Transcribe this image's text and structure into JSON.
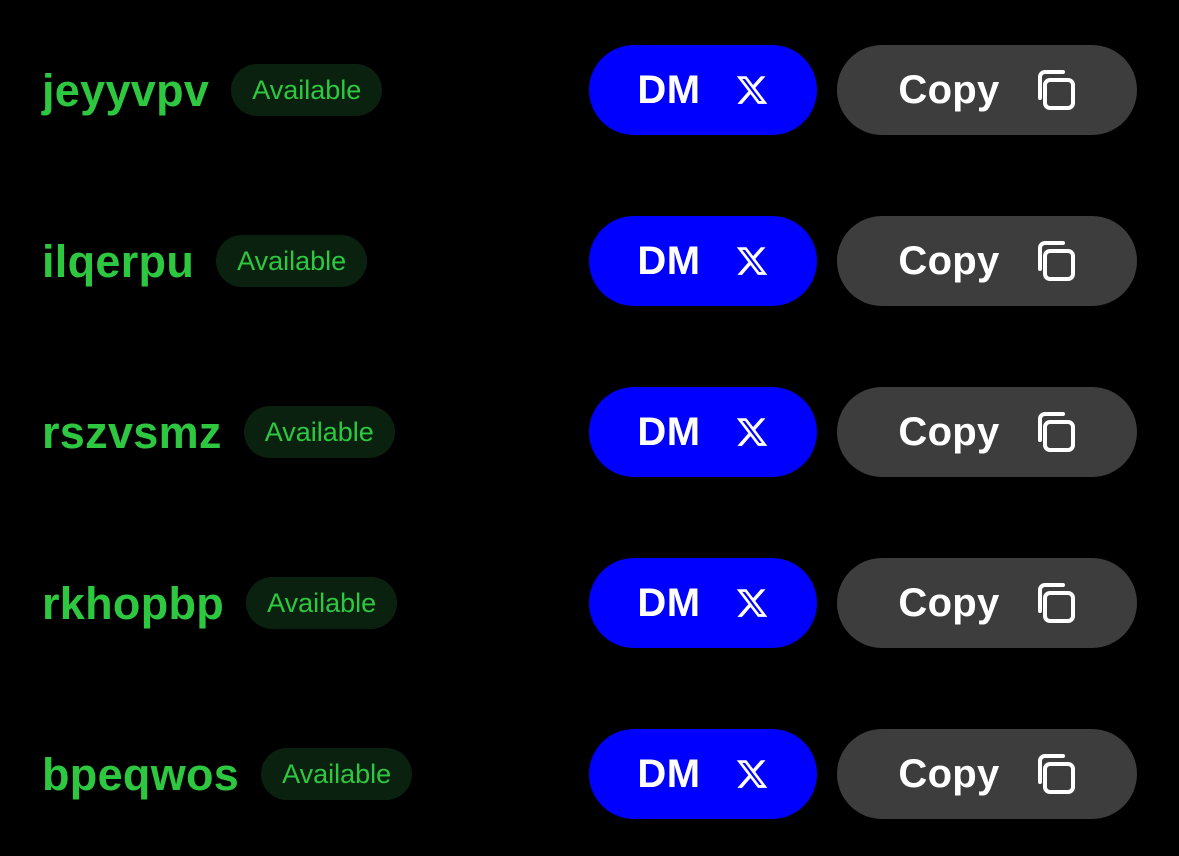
{
  "colors": {
    "background": "#000000",
    "handle_green": "#2ec840",
    "badge_bg": "#0b2110",
    "dm_blue": "#0000ff",
    "copy_gray": "#3d3d3d",
    "button_text": "#ffffff"
  },
  "rows": [
    {
      "handle": "jeyyvpv",
      "status": "Available",
      "dm_label": "DM",
      "dm_icon": "x-logo-icon",
      "copy_label": "Copy",
      "copy_icon": "copy-icon"
    },
    {
      "handle": "ilqerpu",
      "status": "Available",
      "dm_label": "DM",
      "dm_icon": "x-logo-icon",
      "copy_label": "Copy",
      "copy_icon": "copy-icon"
    },
    {
      "handle": "rszvsmz",
      "status": "Available",
      "dm_label": "DM",
      "dm_icon": "x-logo-icon",
      "copy_label": "Copy",
      "copy_icon": "copy-icon"
    },
    {
      "handle": "rkhopbp",
      "status": "Available",
      "dm_label": "DM",
      "dm_icon": "x-logo-icon",
      "copy_label": "Copy",
      "copy_icon": "copy-icon"
    },
    {
      "handle": "bpeqwos",
      "status": "Available",
      "dm_label": "DM",
      "dm_icon": "x-logo-icon",
      "copy_label": "Copy",
      "copy_icon": "copy-icon"
    }
  ]
}
